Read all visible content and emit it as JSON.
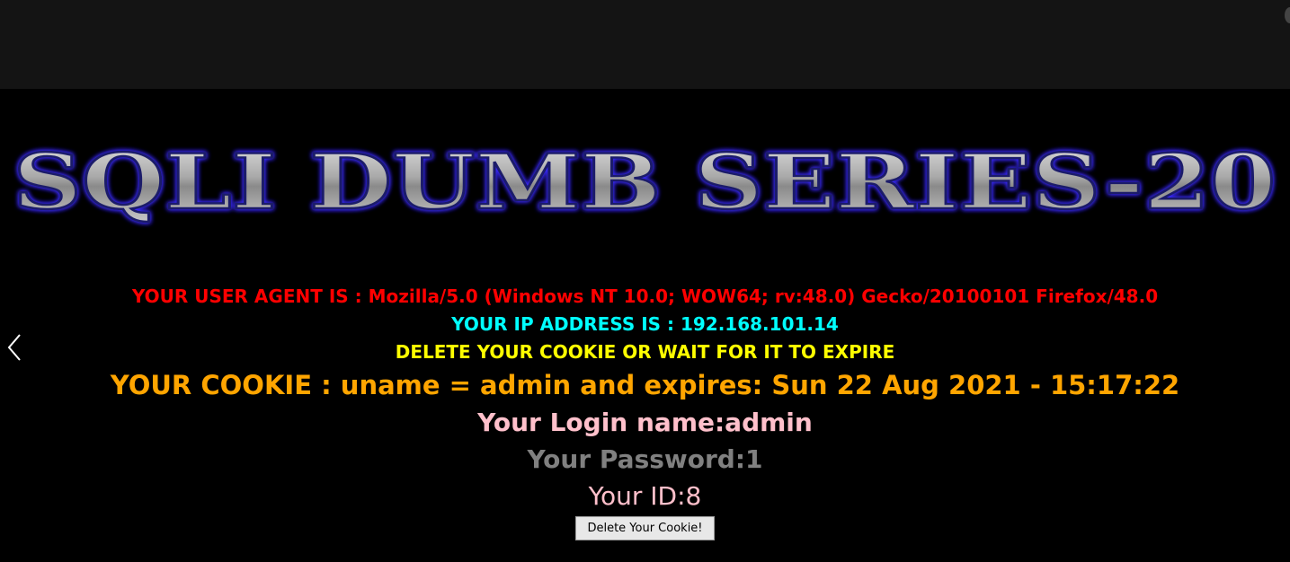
{
  "page": {
    "title": "SQLI DUMB SERIES-20"
  },
  "info": {
    "user_agent": "YOUR USER AGENT IS : Mozilla/5.0 (Windows NT 10.0; WOW64; rv:48.0) Gecko/20100101 Firefox/48.0",
    "ip_address": "YOUR IP ADDRESS IS : 192.168.101.14",
    "delete_notice": "DELETE YOUR COOKIE OR WAIT FOR IT TO EXPIRE",
    "cookie": "YOUR COOKIE : uname = admin and expires: Sun 22 Aug 2021 - 15:17:22",
    "login_name": "Your Login name:admin",
    "password": "Your Password:1",
    "id": "Your ID:8"
  },
  "buttons": {
    "delete_cookie": "Delete Your Cookie!"
  },
  "icons": {
    "prev": "chevron-left-icon"
  },
  "colors": {
    "user_agent": "#ff0000",
    "ip_address": "#00ffff",
    "delete_notice": "#ffff00",
    "cookie": "#ffa500",
    "login_name": "#ffc0cb",
    "password": "#808080",
    "id": "#ffc0cb",
    "title_glow": "#3333ff"
  }
}
